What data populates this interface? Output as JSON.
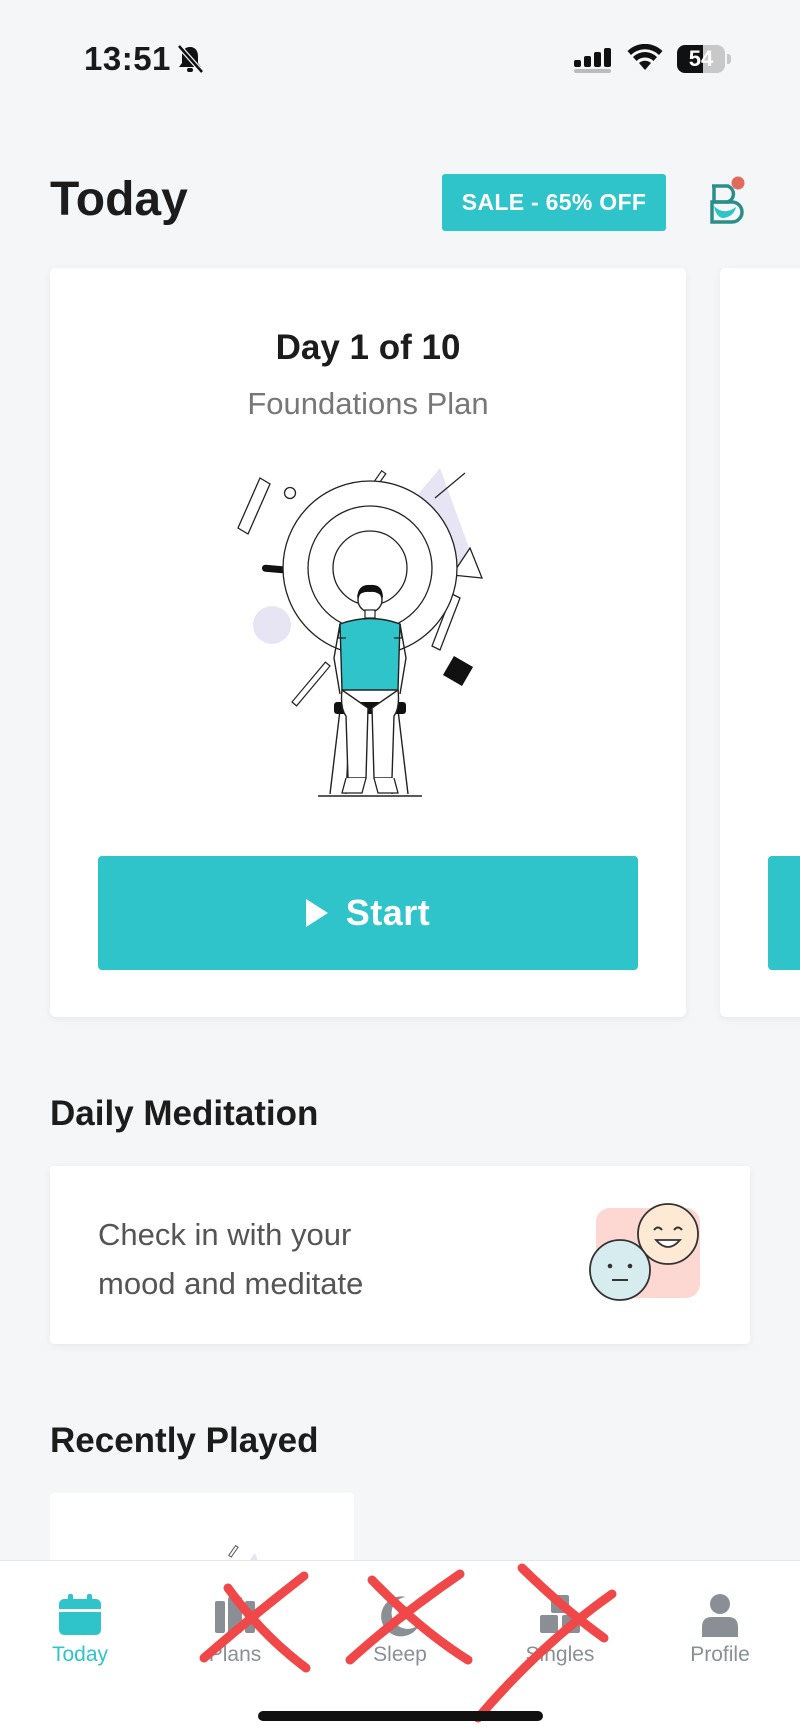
{
  "status_bar": {
    "time": "13:51",
    "battery": "54",
    "icons": [
      "bell-slash-icon",
      "signal-icon",
      "wifi-icon",
      "battery-icon"
    ]
  },
  "header": {
    "title": "Today",
    "sale_label": "SALE - 65% OFF",
    "profile_icon": "headspace-logo-icon",
    "notification_dot": true
  },
  "plan_card": {
    "day": "Day 1 of 10",
    "plan_name": "Foundations Plan",
    "start_label": "Start"
  },
  "daily_meditation": {
    "title": "Daily Meditation",
    "text_line1": "Check in with your",
    "text_line2": "mood and meditate",
    "icon": "mood-faces-icon"
  },
  "recently_played": {
    "title": "Recently Played"
  },
  "tabs": [
    {
      "label": "Today",
      "icon": "calendar-icon",
      "active": true
    },
    {
      "label": "Plans",
      "icon": "plans-icon",
      "active": false
    },
    {
      "label": "Sleep",
      "icon": "moon-icon",
      "active": false
    },
    {
      "label": "Singles",
      "icon": "singles-icon",
      "active": false
    },
    {
      "label": "Profile",
      "icon": "person-icon",
      "active": false
    }
  ],
  "colors": {
    "accent": "#2ec4c9",
    "background": "#f5f6f8",
    "annotation_red": "#f04848"
  }
}
